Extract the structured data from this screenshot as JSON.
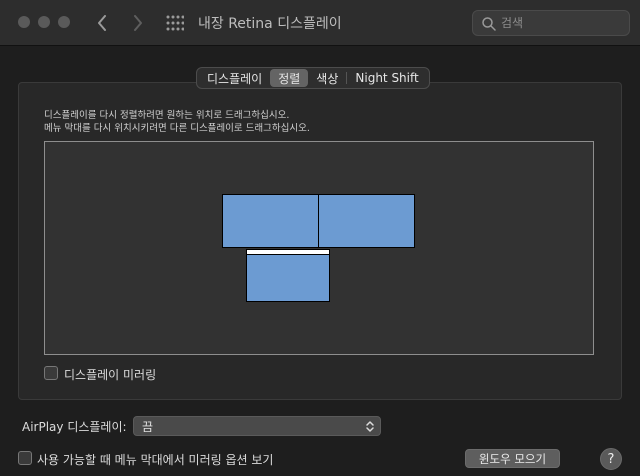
{
  "window": {
    "title": "내장 Retina 디스플레이"
  },
  "search": {
    "placeholder": "검색",
    "value": ""
  },
  "tabs": [
    {
      "label": "디스플레이",
      "active": false
    },
    {
      "label": "정렬",
      "active": true
    },
    {
      "label": "색상",
      "active": false
    },
    {
      "label": "Night Shift",
      "active": false
    }
  ],
  "instructions": {
    "line1": "디스플레이를 다시 정렬하려면 원하는 위치로 드래그하십시오.",
    "line2": "메뉴 막대를 다시 위치시키려면 다른 디스플레이로 드래그하십시오."
  },
  "mirror": {
    "label": "디스플레이 미러링",
    "checked": false
  },
  "airplay": {
    "label": "AirPlay 디스플레이:",
    "value": "끔"
  },
  "menu_option": {
    "label": "사용 가능할 때 메뉴 막대에서 미러링 옵션 보기",
    "checked": false
  },
  "buttons": {
    "gather_windows": "윈도우 모으기",
    "help": "?"
  },
  "colors": {
    "display_fill": "#6c9bd2",
    "menubar": "#ffffff",
    "background": "#1e1e1e",
    "arrangement_bg": "#323232"
  }
}
